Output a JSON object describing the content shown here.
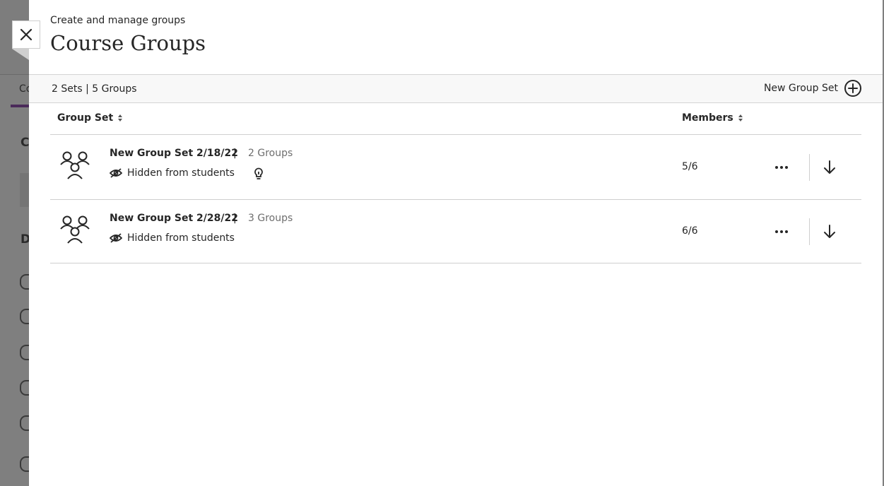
{
  "background": {
    "tab_label": "Co",
    "letters": [
      "C",
      "D"
    ]
  },
  "header": {
    "subtitle": "Create and manage groups",
    "title": "Course Groups"
  },
  "summary": {
    "text": "2 Sets | 5 Groups",
    "new_group_set_label": "New Group Set"
  },
  "table": {
    "columns": {
      "group_set": "Group Set",
      "members": "Members"
    },
    "rows": [
      {
        "name": "New Group Set 2/18/22",
        "separator": "|",
        "groups": "2 Groups",
        "visibility": "Hidden from students",
        "members": "5/6",
        "has_bulb": true
      },
      {
        "name": "New Group Set 2/28/22",
        "separator": "|",
        "groups": "3 Groups",
        "visibility": "Hidden from students",
        "members": "6/6",
        "has_bulb": false
      }
    ]
  },
  "icons": {
    "close": "close-icon",
    "add": "plus-circle-icon",
    "sort": "sort-icon",
    "group": "group-icon",
    "hidden": "eye-slash-icon",
    "bulb": "lightbulb-icon",
    "more": "more-icon",
    "download": "arrow-down-icon"
  }
}
